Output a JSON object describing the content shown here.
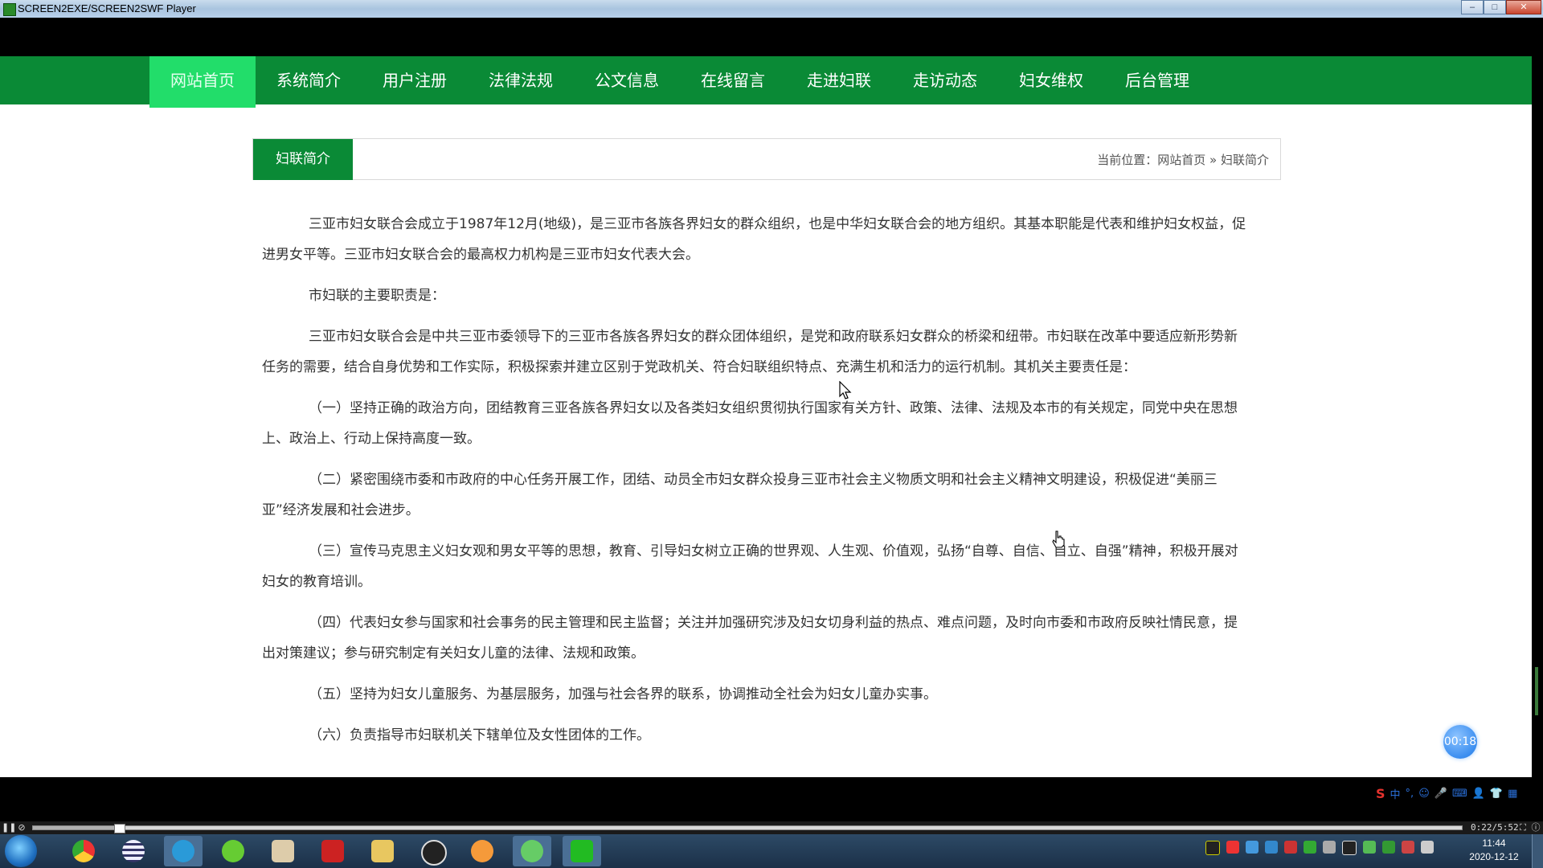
{
  "window": {
    "title": "SCREEN2EXE/SCREEN2SWF Player",
    "controls": {
      "minimize": "–",
      "maximize": "□",
      "close": "✕"
    }
  },
  "nav": {
    "items": [
      {
        "label": "网站首页",
        "active": true
      },
      {
        "label": "系统简介"
      },
      {
        "label": "用户注册"
      },
      {
        "label": "法律法规"
      },
      {
        "label": "公文信息"
      },
      {
        "label": "在线留言"
      },
      {
        "label": "走进妇联"
      },
      {
        "label": "走访动态"
      },
      {
        "label": "妇女维权"
      },
      {
        "label": "后台管理"
      }
    ]
  },
  "section": {
    "tab_label": "妇联简介",
    "breadcrumb": "当前位置：网站首页 » 妇联简介"
  },
  "content": {
    "paragraphs": [
      "三亚市妇女联合会成立于1987年12月(地级)，是三亚市各族各界妇女的群众组织，也是中华妇女联合会的地方组织。其基本职能是代表和维护妇女权益，促进男女平等。三亚市妇女联合会的最高权力机构是三亚市妇女代表大会。",
      "市妇联的主要职责是：",
      "三亚市妇女联合会是中共三亚市委领导下的三亚市各族各界妇女的群众团体组织，是党和政府联系妇女群众的桥梁和纽带。市妇联在改革中要适应新形势新任务的需要，结合自身优势和工作实际，积极探索并建立区别于党政机关、符合妇联组织特点、充满生机和活力的运行机制。其机关主要责任是：",
      "（一）坚持正确的政治方向，团结教育三亚各族各界妇女以及各类妇女组织贯彻执行国家有关方针、政策、法律、法规及本市的有关规定，同党中央在思想上、政治上、行动上保持高度一致。",
      "（二）紧密围绕市委和市政府的中心任务开展工作，团结、动员全市妇女群众投身三亚市社会主义物质文明和社会主义精神文明建设，积极促进“美丽三亚”经济发展和社会进步。",
      "（三）宣传马克思主义妇女观和男女平等的思想，教育、引导妇女树立正确的世界观、人生观、价值观，弘扬“自尊、自信、自立、自强”精神，积极开展对妇女的教育培训。",
      "（四）代表妇女参与国家和社会事务的民主管理和民主监督；关注并加强研究涉及妇女切身利益的热点、难点问题，及时向市委和市政府反映社情民意，提出对策建议；参与研究制定有关妇女儿童的法律、法规和政策。",
      "（五）坚持为妇女儿童服务、为基层服务，加强与社会各界的联系，协调推动全社会为妇女儿童办实事。",
      "（六）负责指导市妇联机关下辖单位及女性团体的工作。"
    ]
  },
  "overlay": {
    "timer": "00:18"
  },
  "player": {
    "time": "0:22/5:52",
    "progress": 0.06
  },
  "ime": {
    "items": [
      "S",
      "中",
      "°,",
      "☺",
      "🎤",
      "⌨",
      "👤",
      "👕",
      "▦"
    ]
  },
  "taskbar": {
    "apps": [
      "chrome",
      "app-2",
      "browser",
      "360",
      "notepad",
      "flash",
      "explorer",
      "qq",
      "audio",
      "wechat",
      "player"
    ],
    "clock_time": "11:44",
    "clock_date": "2020-12-12"
  },
  "colors": {
    "nav_bg": "#0a8a36",
    "nav_active": "#22dd6a",
    "text": "#333333"
  }
}
